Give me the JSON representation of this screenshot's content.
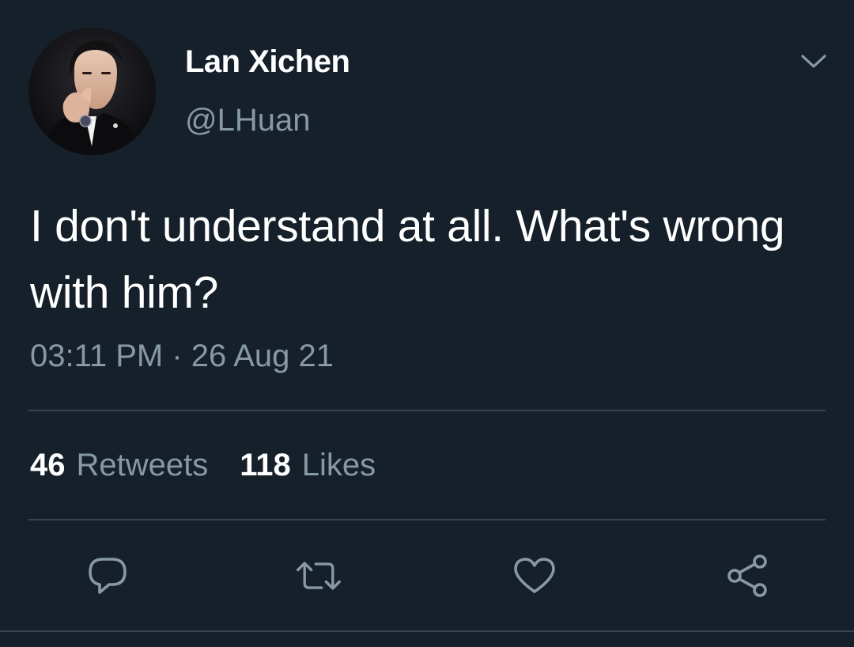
{
  "tweet": {
    "display_name": "Lan Xichen",
    "handle": "@LHuan",
    "text": "I don't understand at all. What's wrong with him?",
    "timestamp": "03:11 PM · 26 Aug 21"
  },
  "stats": {
    "retweets_count": "46",
    "retweets_label": "Retweets",
    "likes_count": "118",
    "likes_label": "Likes"
  },
  "icons": {
    "more": "chevron-down-icon",
    "reply": "reply-icon",
    "retweet": "retweet-icon",
    "like": "heart-icon",
    "share": "share-icon"
  },
  "colors": {
    "background": "#15202b",
    "primary_text": "#ffffff",
    "secondary_text": "#8899a6",
    "divider": "#38444d"
  }
}
